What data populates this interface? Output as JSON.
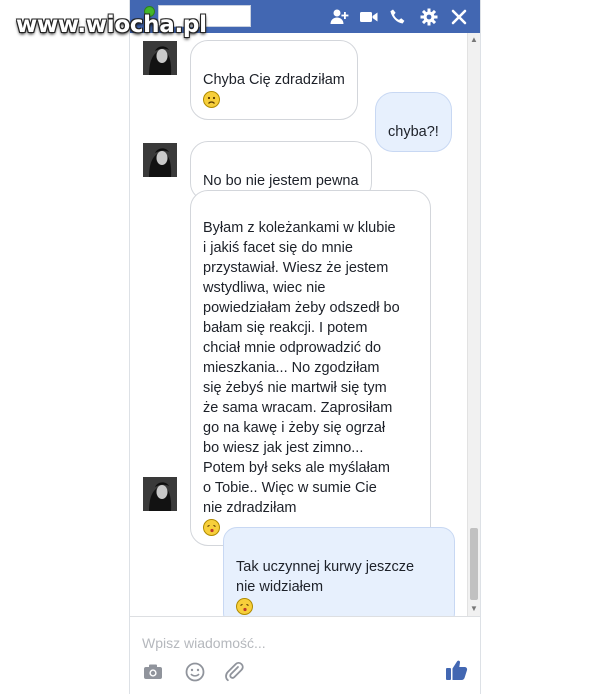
{
  "watermark": "www.wiocha.pl",
  "header": {
    "icons": [
      "add-friend-icon",
      "video-call-icon",
      "phone-icon",
      "gear-icon",
      "close-icon"
    ]
  },
  "messages": [
    {
      "sender": "them",
      "text": "Chyba Cię zdradziłam",
      "emoji": "sad-emoji"
    },
    {
      "sender": "me",
      "text": "chyba?!"
    },
    {
      "sender": "them",
      "text": "No bo nie jestem pewna"
    },
    {
      "sender": "them",
      "text": "Byłam z koleżankami w klubie\ni jakiś facet się do mnie\nprzystawiał. Wiesz że jestem\nwstydliwa, wiec nie\npowiedziałam żeby odszedł bo\nbałam się reakcji. I potem\nchciał mnie odprowadzić do\nmieszkania... No zgodziłam\nsię żebyś nie martwił się tym\nże sama wracam. Zaprosiłam\ngo na kawę i żeby się ogrzał\nbo wiesz jak jest zimno...\nPotem był seks ale myślałam\no Tobie.. Więc w sumie Cie\nnie zdradziłam",
      "emoji": "kiss-emoji"
    },
    {
      "sender": "me",
      "text": "Tak uczynnej kurwy jeszcze\nnie widziałem",
      "emoji": "kiss-emoji"
    }
  ],
  "composer": {
    "placeholder": "Wpisz wiadomość...",
    "icons": [
      "camera-icon",
      "emoji-icon",
      "attachment-icon",
      "like-icon"
    ]
  },
  "colors": {
    "header": "#4267b2",
    "outgoing_bubble": "#e7f0fd",
    "incoming_bubble": "#ffffff",
    "like": "#4267b2"
  }
}
